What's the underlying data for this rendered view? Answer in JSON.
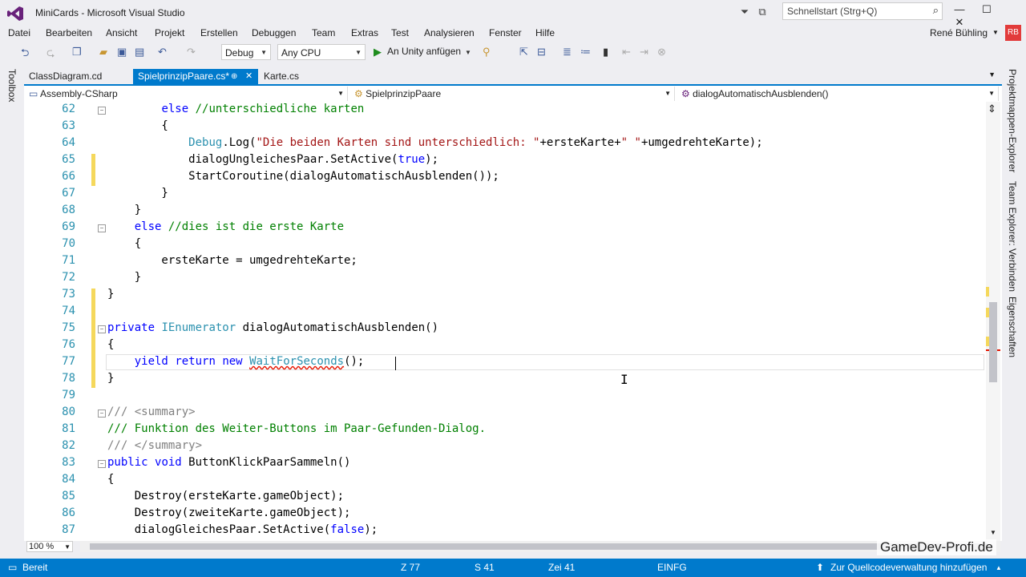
{
  "title": "MiniCards - Microsoft Visual Studio",
  "quicklaunch_placeholder": "Schnellstart (Strg+Q)",
  "menu": [
    "Datei",
    "Bearbeiten",
    "Ansicht",
    "Projekt",
    "Erstellen",
    "Debuggen",
    "Team",
    "Extras",
    "Test",
    "Analysieren",
    "Fenster",
    "Hilfe"
  ],
  "user": {
    "name": "René Bühling",
    "initials": "RB"
  },
  "toolbar": {
    "config": "Debug",
    "platform": "Any CPU",
    "attach": "An Unity anfügen"
  },
  "toolbox_label": "Toolbox",
  "right_panels": [
    "Projektmappen-Explorer",
    "Team Explorer: Verbinden",
    "Eigenschaften"
  ],
  "tabs": [
    {
      "label": "ClassDiagram.cd",
      "active": false
    },
    {
      "label": "SpielprinzipPaare.cs*",
      "active": true,
      "pin": "⊕",
      "close": "✕"
    },
    {
      "label": "Karte.cs",
      "active": false
    }
  ],
  "nav": {
    "project": "Assembly-CSharp",
    "class": "SpielprinzipPaare",
    "member": "dialogAutomatischAusblenden()"
  },
  "lines": [
    {
      "n": "62",
      "t": "        else //unterschiedliche karten"
    },
    {
      "n": "63",
      "t": "        {"
    },
    {
      "n": "64",
      "t": "            Debug.Log(\"Die beiden Karten sind unterschiedlich: \"+ersteKarte+\" \"+umgedrehteKarte);"
    },
    {
      "n": "65",
      "t": "            dialogUngleichesPaar.SetActive(true);"
    },
    {
      "n": "66",
      "t": "            StartCoroutine(dialogAutomatischAusblenden());"
    },
    {
      "n": "67",
      "t": "        }"
    },
    {
      "n": "68",
      "t": "    }"
    },
    {
      "n": "69",
      "t": "    else //dies ist die erste Karte"
    },
    {
      "n": "70",
      "t": "    {"
    },
    {
      "n": "71",
      "t": "        ersteKarte = umgedrehteKarte;"
    },
    {
      "n": "72",
      "t": "    }"
    },
    {
      "n": "73",
      "t": "}"
    },
    {
      "n": "74",
      "t": ""
    },
    {
      "n": "75",
      "t": "private IEnumerator dialogAutomatischAusblenden()"
    },
    {
      "n": "76",
      "t": "{"
    },
    {
      "n": "77",
      "t": "    yield return new WaitForSeconds();"
    },
    {
      "n": "78",
      "t": "}"
    },
    {
      "n": "79",
      "t": ""
    },
    {
      "n": "80",
      "t": "/// <summary>"
    },
    {
      "n": "81",
      "t": "/// Funktion des Weiter-Buttons im Paar-Gefunden-Dialog."
    },
    {
      "n": "82",
      "t": "/// </summary>"
    },
    {
      "n": "83",
      "t": "public void ButtonKlickPaarSammeln()"
    },
    {
      "n": "84",
      "t": "{"
    },
    {
      "n": "85",
      "t": "    Destroy(ersteKarte.gameObject);"
    },
    {
      "n": "86",
      "t": "    Destroy(zweiteKarte.gameObject);"
    },
    {
      "n": "87",
      "t": "    dialogGleichesPaar.SetActive(false);"
    }
  ],
  "zoom": "100 %",
  "status": {
    "ready": "Bereit",
    "line": "Z 77",
    "col": "S 41",
    "char": "Zei 41",
    "mode": "EINFG",
    "vcs": "Zur Quellcodeverwaltung hinzufügen"
  },
  "watermark": "GameDev-Profi.de"
}
